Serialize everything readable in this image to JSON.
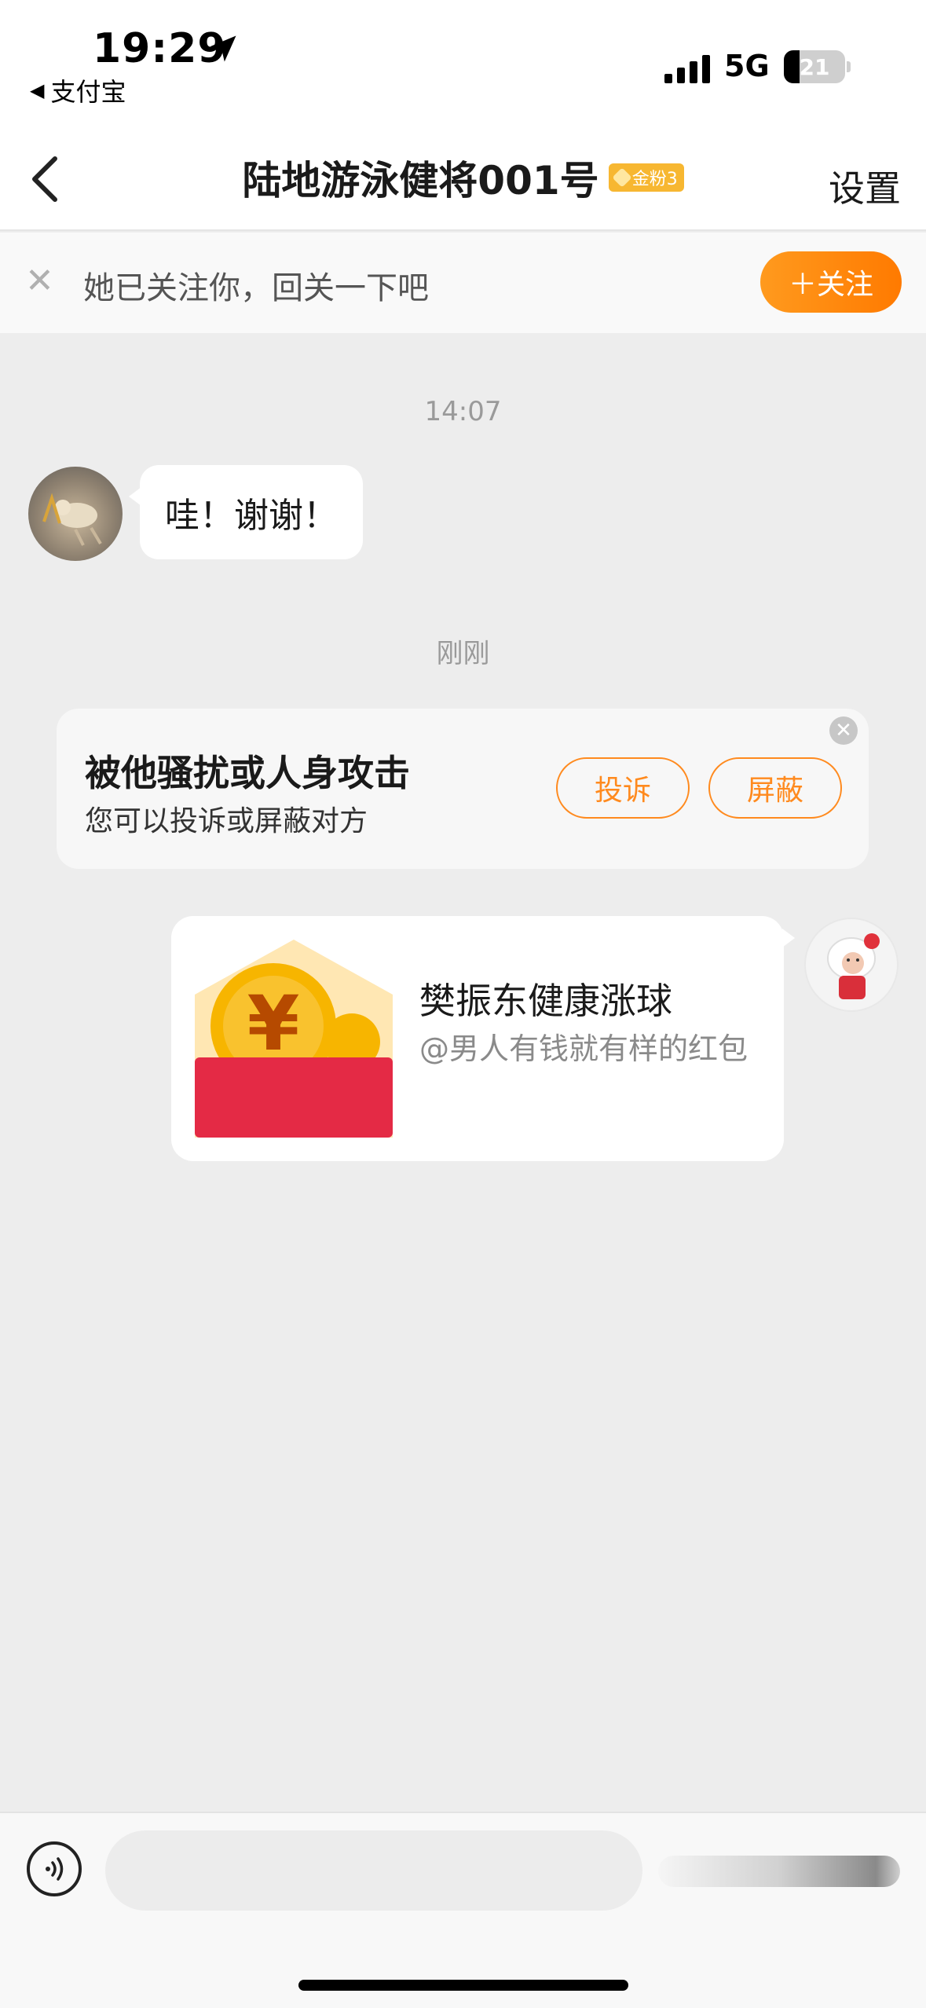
{
  "status_bar": {
    "time": "19:29",
    "back_app": "支付宝",
    "network": "5G",
    "battery": "21"
  },
  "nav": {
    "title": "陆地游泳健将001号",
    "fan_badge": "金粉3",
    "settings": "设置"
  },
  "follow_banner": {
    "text": "她已关注你，回关一下吧",
    "follow_button": "＋关注"
  },
  "messages": {
    "time_1": "14:07",
    "received_text": "哇！谢谢！",
    "time_2": "刚刚"
  },
  "warning_card": {
    "title": "被他骚扰或人身攻击",
    "subtitle": "您可以投诉或屏蔽对方",
    "complain_button": "投诉",
    "block_button": "屏蔽"
  },
  "red_packet": {
    "title": "樊振东健康涨球",
    "subtitle": "@男人有钱就有样的红包"
  },
  "colors": {
    "accent": "#ff8a1e",
    "packet_red": "#e42a45",
    "coin_gold": "#f7b500"
  },
  "icons": [
    "location-arrow-icon",
    "back-chevron-icon",
    "close-icon",
    "voice-icon",
    "signal-icon",
    "battery-icon"
  ]
}
